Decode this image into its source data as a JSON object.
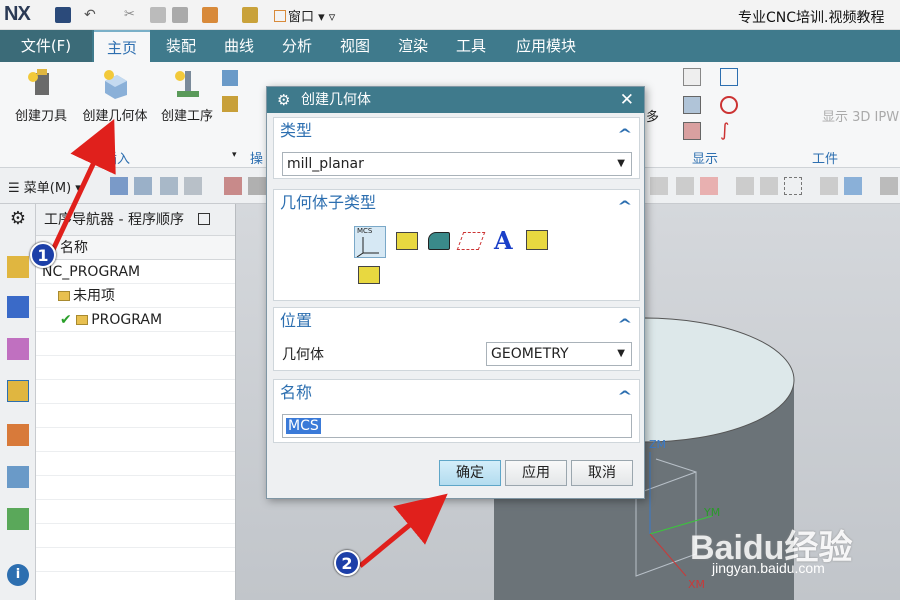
{
  "app": {
    "logo": "NX",
    "title": "专业CNC培训.视频教程",
    "window_menu": "窗口"
  },
  "ribbon_tabs": {
    "file": "文件(F)",
    "tabs": [
      "主页",
      "装配",
      "曲线",
      "分析",
      "视图",
      "渲染",
      "工具",
      "应用模块"
    ],
    "active": "主页"
  },
  "ribbon": {
    "buttons": [
      "创建刀具",
      "创建几何体",
      "创建工序"
    ],
    "partial_labels": [
      "多",
      "显示 3D IPW"
    ],
    "group_labels": [
      "插入",
      "操",
      "显示",
      "工件"
    ]
  },
  "toolbar2": {
    "menu_label": "菜单(M)"
  },
  "navigator": {
    "title": "工序导航器 - 程序顺序",
    "column_header": "名称",
    "rows": [
      "NC_PROGRAM",
      "未用项",
      "PROGRAM"
    ]
  },
  "dialog": {
    "title": "创建几何体",
    "type_section": {
      "title": "类型",
      "value": "mill_planar"
    },
    "subtype_section": {
      "title": "几何体子类型",
      "icons": [
        "mcs-icon",
        "workpiece-icon",
        "mill-area-icon",
        "mill-boundary-icon",
        "text-geometry-icon",
        "mill-geom-icon",
        "mill-bnd-icon"
      ],
      "mcs_label": "MCS"
    },
    "position_section": {
      "title": "位置",
      "label": "几何体",
      "value": "GEOMETRY"
    },
    "name_section": {
      "title": "名称",
      "value": "MCS"
    },
    "buttons": {
      "ok": "确定",
      "apply": "应用",
      "cancel": "取消"
    }
  },
  "viewport": {
    "axis_labels": [
      "ZM",
      "YM",
      "XM"
    ]
  },
  "callouts": [
    "1",
    "2"
  ],
  "watermark": {
    "brand": "Baidu经验",
    "url": "jingyan.baidu.com"
  },
  "colors": {
    "ribbon_tab_bg": "#3f7a8c",
    "accent_blue": "#2d6fb0",
    "arrow_red": "#e0201c",
    "callout_blue": "#1c3fa8"
  }
}
